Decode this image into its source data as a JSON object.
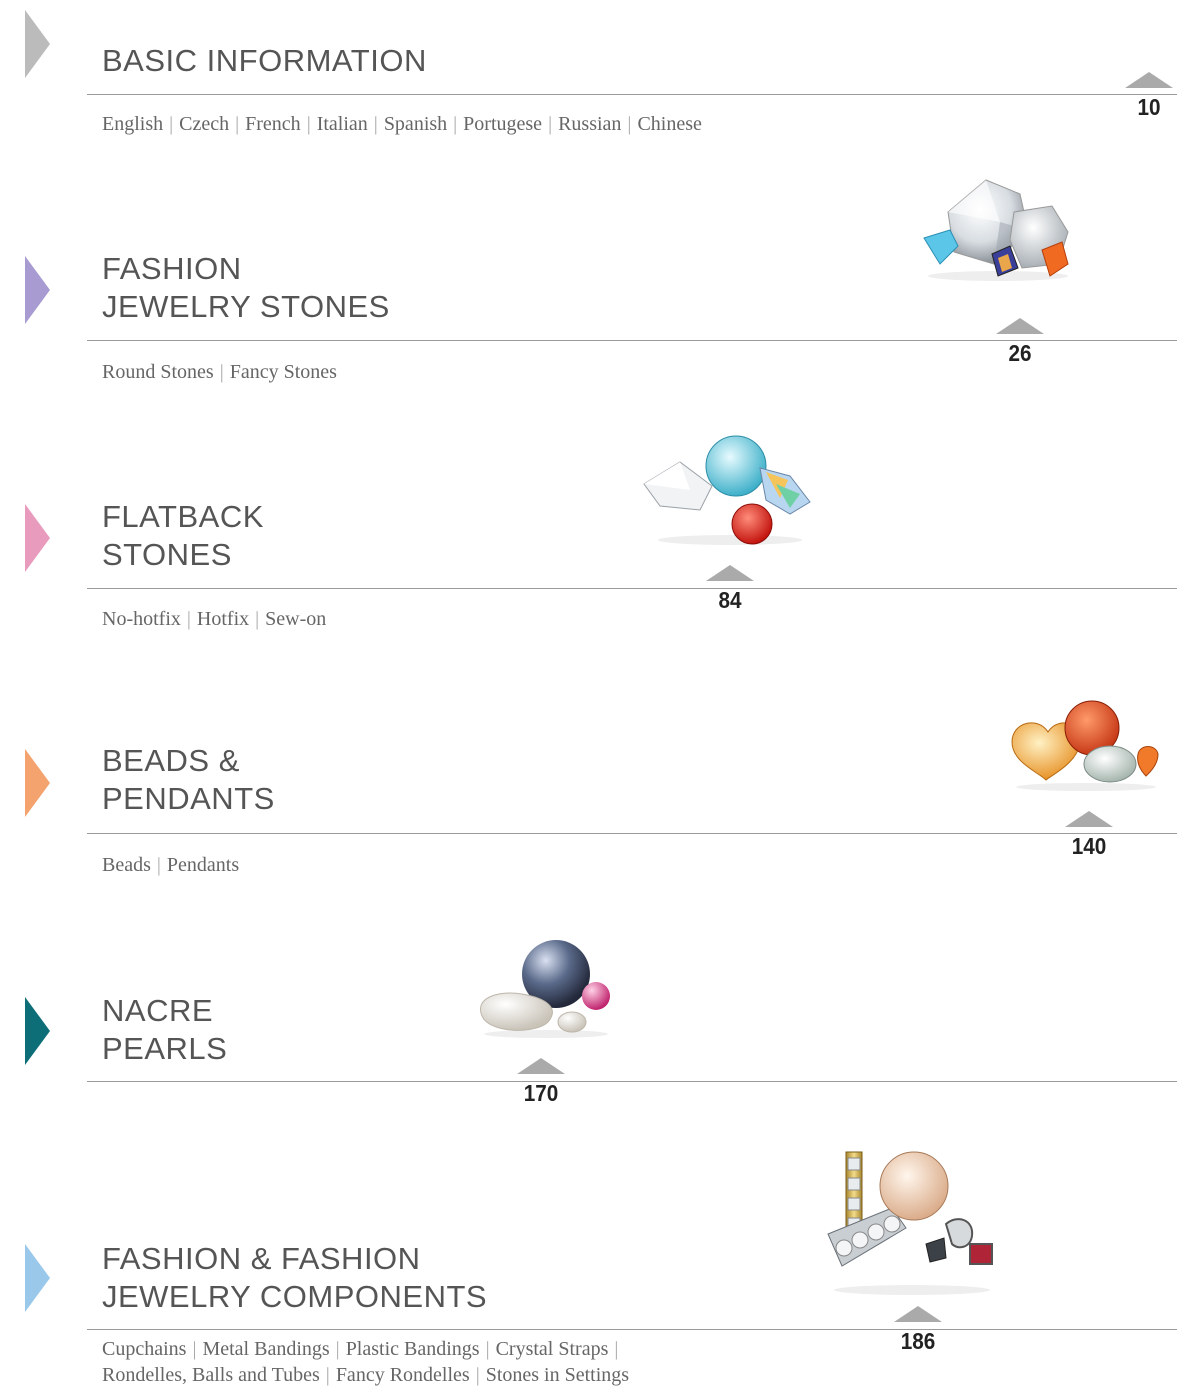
{
  "colors": {
    "basic": "#bbbbbb",
    "fashion": "#a89bd2",
    "flatback": "#e99bbd",
    "beads": "#f4a36e",
    "nacre": "#0e6e78",
    "components": "#99c8ea"
  },
  "sections": [
    {
      "title_lines": [
        "BASIC INFORMATION"
      ],
      "subtitles": [
        "English",
        "Czech",
        "French",
        "Italian",
        "Spanish",
        "Portugese",
        "Russian",
        "Chinese"
      ],
      "page": "10"
    },
    {
      "title_lines": [
        "FASHION",
        "JEWELRY STONES"
      ],
      "subtitles": [
        "Round Stones",
        "Fancy Stones"
      ],
      "page": "26",
      "icon": "crystal-stones-image"
    },
    {
      "title_lines": [
        "FLATBACK",
        "STONES"
      ],
      "subtitles": [
        "No-hotfix",
        "Hotfix",
        "Sew-on"
      ],
      "page": "84",
      "icon": "flatback-stones-image"
    },
    {
      "title_lines": [
        "BEADS &",
        "PENDANTS"
      ],
      "subtitles": [
        "Beads",
        "Pendants"
      ],
      "page": "140",
      "icon": "beads-image"
    },
    {
      "title_lines": [
        "NACRE",
        "PEARLS"
      ],
      "subtitles": [],
      "page": "170",
      "icon": "pearls-image"
    },
    {
      "title_lines": [
        "FASHION & FASHION",
        "JEWELRY COMPONENTS"
      ],
      "subtitles_line1": [
        "Cupchains",
        "Metal Bandings",
        "Plastic Bandings",
        "Crystal Straps"
      ],
      "subtitles_line2": [
        "Rondelles, Balls and Tubes",
        "Fancy Rondelles",
        "Stones in Settings"
      ],
      "page": "186",
      "icon": "components-image"
    }
  ]
}
